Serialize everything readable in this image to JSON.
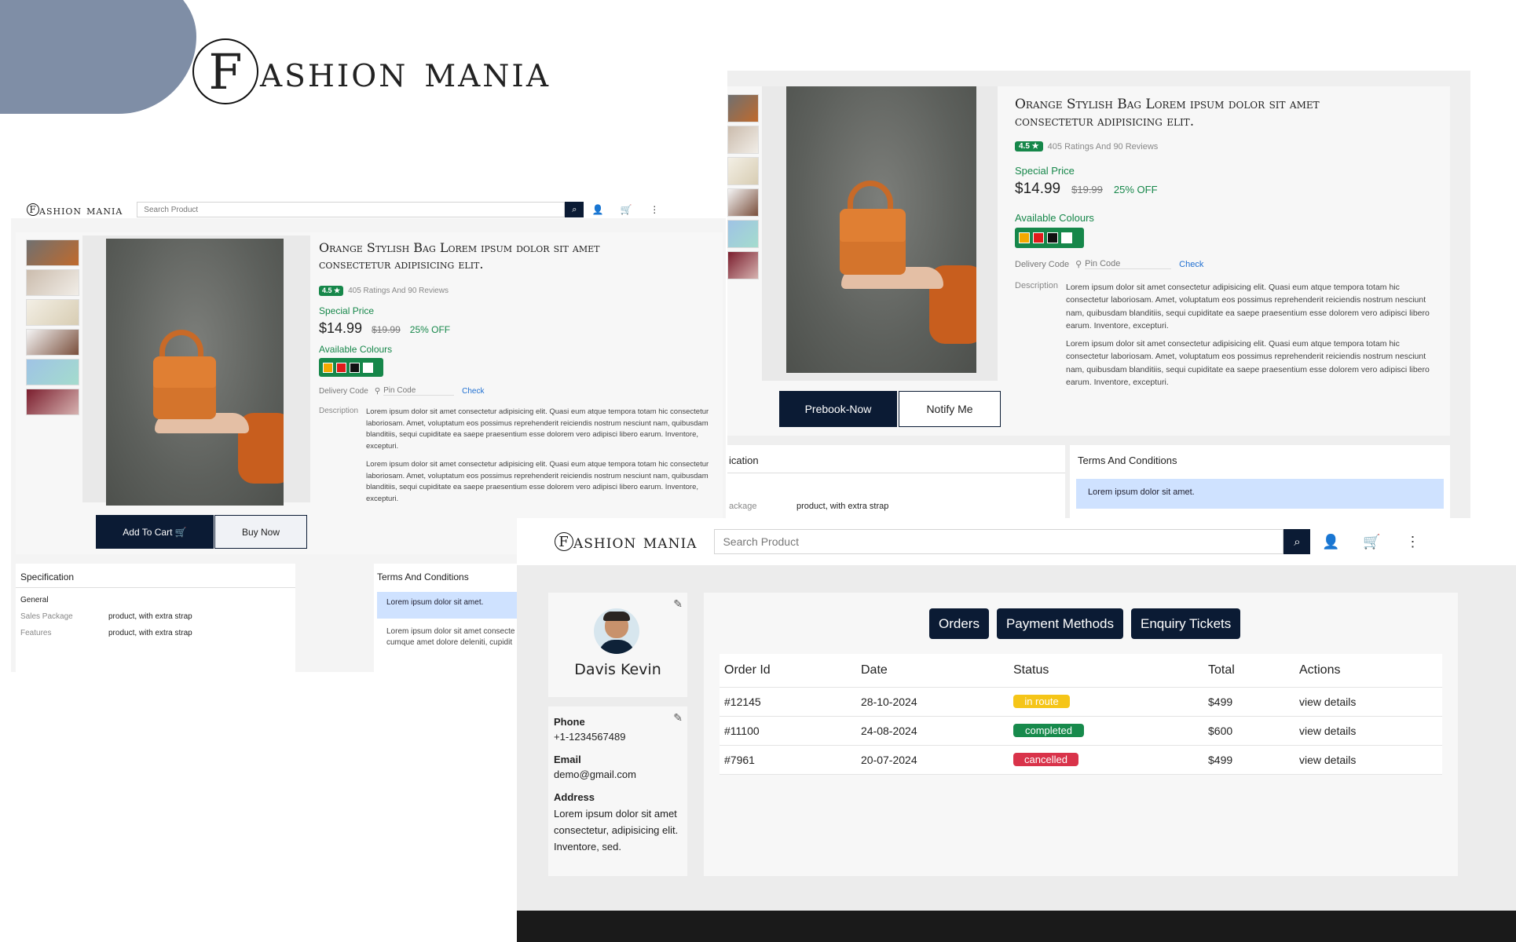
{
  "brand": {
    "initial": "F",
    "rest": "ashion mania",
    "small_initial": "F",
    "small_rest": "ashion mania"
  },
  "search": {
    "placeholder": "Search Product"
  },
  "product": {
    "title": "Orange Stylish Bag Lorem ipsum dolor sit amet consectetur adipisicing elit.",
    "rating": "4.5 ★",
    "rating_text": "405 Ratings And 90 Reviews",
    "special_price_label": "Special Price",
    "price": "$14.99",
    "old_price": "$19.99",
    "discount": "25% OFF",
    "colours_label": "Available Colours",
    "colours": [
      "#f2a900",
      "#e01b1b",
      "#111111",
      "#ffffff"
    ],
    "delivery_label": "Delivery Code",
    "pin_placeholder": "Pin Code",
    "check_label": "Check",
    "description_label": "Description",
    "description_1": "Lorem ipsum dolor sit amet consectetur adipisicing elit. Quasi eum atque tempora totam hic consectetur laboriosam. Amet, voluptatum eos possimus reprehenderit reiciendis nostrum nesciunt nam, quibusdam blanditiis, sequi cupiditate ea saepe praesentium esse dolorem vero adipisci libero earum. Inventore, excepturi.",
    "description_2": "Lorem ipsum dolor sit amet consectetur adipisicing elit. Quasi eum atque tempora totam hic consectetur laboriosam. Amet, voluptatum eos possimus reprehenderit reiciendis nostrum nesciunt nam, quibusdam blanditiis, sequi cupiditate ea saepe praesentium esse dolorem vero adipisci libero earum. Inventore, excepturi.",
    "add_to_cart": "Add To Cart 🛒",
    "buy_now": "Buy Now",
    "prebook": "Prebook-Now",
    "notify": "Notify Me"
  },
  "spec": {
    "title": "Specification",
    "title_cut": "ication",
    "general": "General",
    "rows": [
      {
        "label": "Sales Package",
        "value": "product, with extra strap"
      },
      {
        "label": "Features",
        "value": "product, with extra strap"
      }
    ],
    "package_cut": "ackage",
    "package_value": "product, with extra strap"
  },
  "terms": {
    "title": "Terms And Conditions",
    "item": "Lorem ipsum dolor sit amet.",
    "body": "Lorem ipsum dolor sit amet consecte cumque amet dolore deleniti, cupidit"
  },
  "profile": {
    "name": "Davis Kevin",
    "phone_label": "Phone",
    "phone": "+1-1234567489",
    "email_label": "Email",
    "email": "demo@gmail.com",
    "address_label": "Address",
    "address": "Lorem ipsum dolor sit amet consectetur, adipisicing elit. Inventore, sed."
  },
  "tabs": [
    "Orders",
    "Payment Methods",
    "Enquiry Tickets"
  ],
  "orders": {
    "headers": [
      "Order Id",
      "Date",
      "Status",
      "Total",
      "Actions"
    ],
    "rows": [
      {
        "id": "#12145",
        "date": "28-10-2024",
        "status": "in route",
        "status_color": "#f5c518",
        "total": "$499",
        "action": "view details"
      },
      {
        "id": "#11100",
        "date": "24-08-2024",
        "status": "completed",
        "status_color": "#178a4c",
        "total": "$600",
        "action": "view details"
      },
      {
        "id": "#7961",
        "date": "20-07-2024",
        "status": "cancelled",
        "status_color": "#d9334a",
        "total": "$499",
        "action": "view details"
      }
    ]
  }
}
